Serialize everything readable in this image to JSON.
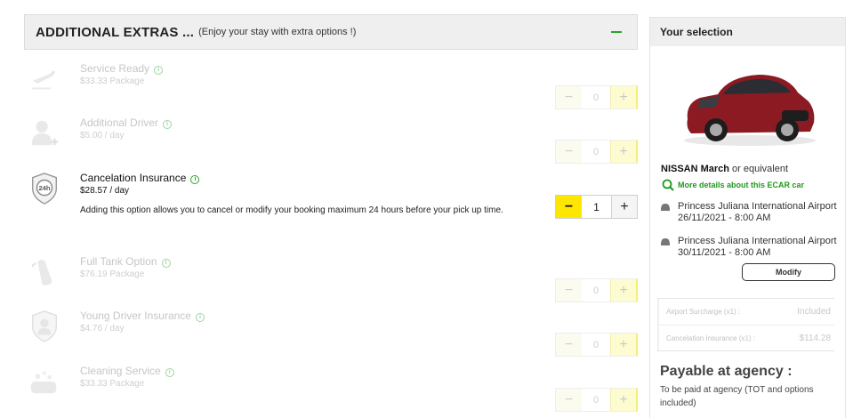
{
  "extras": {
    "title": "ADDITIONAL EXTRAS ...",
    "subtitle": "(Enjoy your stay with extra options !)",
    "options": [
      {
        "name": "Service Ready",
        "price": "$33.33 Package",
        "quantity": "0",
        "state": "disabled",
        "icon": "airplane-icon"
      },
      {
        "name": "Additional Driver",
        "price": "$5.00 / day",
        "quantity": "0",
        "state": "disabled",
        "icon": "add-driver-icon"
      },
      {
        "name": "Cancelation Insurance",
        "price": "$28.57 / day",
        "quantity": "1",
        "state": "active",
        "icon": "24h-shield-icon",
        "description": "Adding this option allows you to cancel or modify your booking maximum 24 hours before your pick up time."
      },
      {
        "name": "Full Tank Option",
        "price": "$76.19 Package",
        "quantity": "0",
        "state": "disabled",
        "icon": "fuel-nozzle-icon"
      },
      {
        "name": "Young Driver Insurance",
        "price": "$4.76 / day",
        "quantity": "0",
        "state": "disabled",
        "icon": "young-driver-shield-icon"
      },
      {
        "name": "Cleaning Service",
        "price": "$33.33 Package",
        "quantity": "0",
        "state": "disabled",
        "icon": "cleaning-icon"
      }
    ],
    "stepper": {
      "minus": "−",
      "plus": "+"
    },
    "info_glyph": "i"
  },
  "selection": {
    "title": "Your selection",
    "car": {
      "name": "NISSAN March",
      "suffix": "or equivalent",
      "color": "#8c1a22"
    },
    "details_link": "More details about this ECAR car",
    "pickup": {
      "location": "Princess Juliana International Airport",
      "datetime": "26/11/2021 - 8:00 AM"
    },
    "dropoff": {
      "location": "Princess Juliana International Airport",
      "datetime": "30/11/2021 - 8:00 AM"
    },
    "modify_label": "Modify",
    "charges": [
      {
        "label": "Airport Surcharge (x1) :",
        "amount": "Included"
      },
      {
        "label": "Cancelation Insurance (x1) :",
        "amount": "$114.28"
      }
    ],
    "payable_title": "Payable at agency :",
    "payable_note": "To be paid at agency (TOT and options included)"
  },
  "colors": {
    "accent_yellow": "#ffe600",
    "accent_green": "#2aa52a"
  }
}
